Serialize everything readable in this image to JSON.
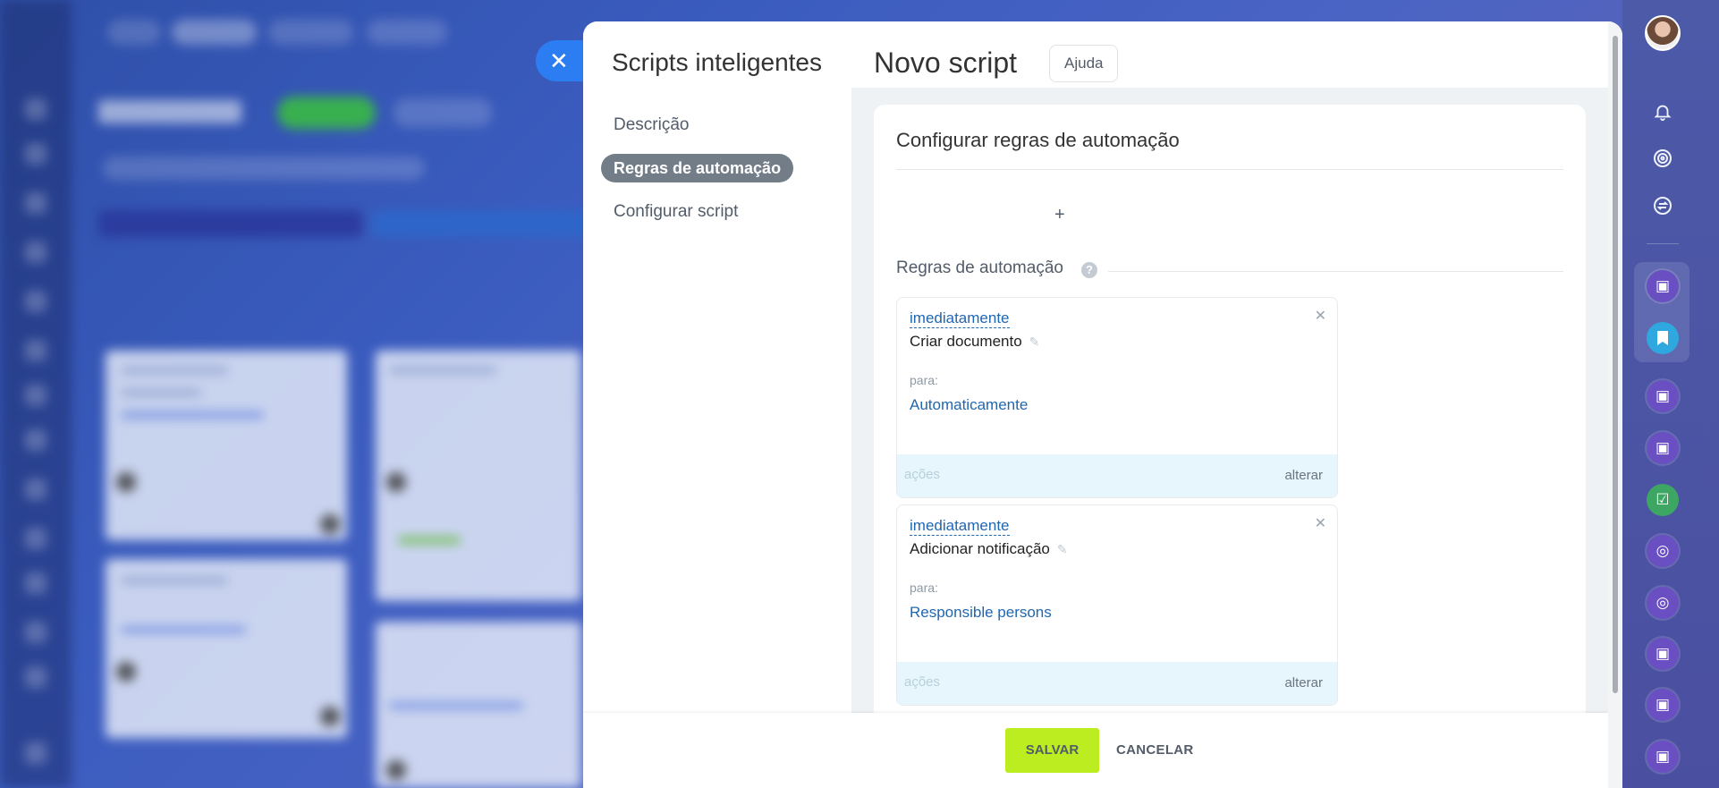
{
  "slider": {
    "title": "Scripts inteligentes",
    "nav": [
      {
        "label": "Descrição",
        "active": false
      },
      {
        "label": "Regras de automação",
        "active": true
      },
      {
        "label": "Configurar script",
        "active": false
      }
    ]
  },
  "content": {
    "title": "Novo script",
    "help_label": "Ajuda",
    "card_title": "Configurar regras de automação",
    "add_symbol": "+",
    "section_label": "Regras de automação",
    "help_icon_glyph": "?",
    "rules": [
      {
        "when": "imediatamente",
        "name": "Criar documento",
        "for_label": "para:",
        "target": "Automaticamente",
        "actions_label": "ações",
        "change_label": "alterar"
      },
      {
        "when": "imediatamente",
        "name": "Adicionar notificação",
        "for_label": "para:",
        "target": "Responsible persons",
        "actions_label": "ações",
        "change_label": "alterar"
      }
    ]
  },
  "footer": {
    "save_label": "SALVAR",
    "cancel_label": "CANCELAR"
  },
  "colors": {
    "accent_blue": "#2d7df2",
    "save_green": "#bbed21",
    "link_blue": "#2067b0",
    "nav_active": "#737d88"
  },
  "icons": {
    "close": "close-icon",
    "bell": "bell-icon",
    "target": "target-icon",
    "sync": "sync-icon",
    "pencil": "pencil-icon"
  }
}
